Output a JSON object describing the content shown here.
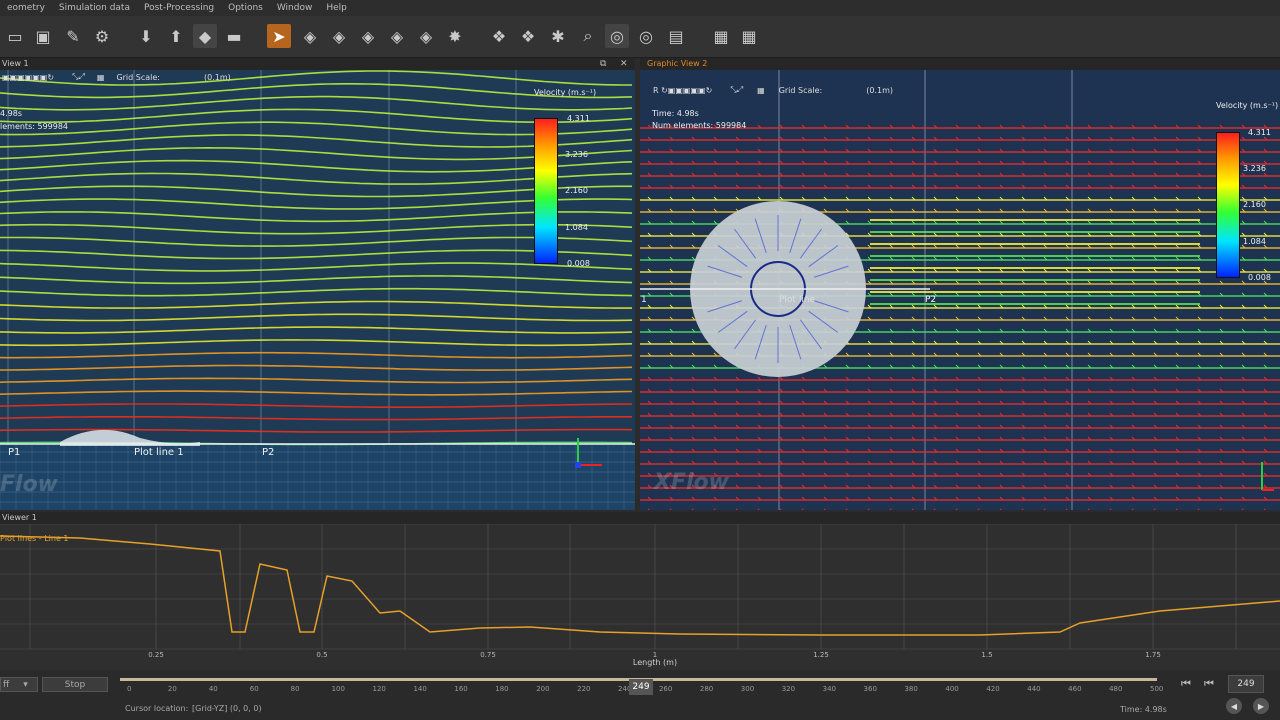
{
  "menu": [
    "eometry",
    "Simulation data",
    "Post-Processing",
    "Options",
    "Window",
    "Help"
  ],
  "toolbar_icons": [
    "open-icon",
    "save-icon",
    "edit-icon",
    "gear-icon",
    "import-icon",
    "export-icon",
    "cube-icon",
    "ruler-icon",
    "select-arrow-icon",
    "select-cube-icon",
    "select-cube-icon",
    "select-cube-icon",
    "select-cube-icon",
    "select-cube-icon",
    "select-burst-icon",
    "transform-icon",
    "transform-icon",
    "wrench-icon",
    "zoom-icon",
    "target-icon",
    "target-icon",
    "clapper-icon",
    "window-icon",
    "window-icon"
  ],
  "view1": {
    "title": "View 1",
    "grid_scale_label": "Grid Scale:",
    "grid_scale_value": "(0.1m)",
    "time": "4.98s",
    "elements": "lements: 599984",
    "colorbar": {
      "title": "Velocity (m.s⁻¹)",
      "labels": [
        "4.311",
        "3.236",
        "2.160",
        "1.084",
        "0.008"
      ]
    },
    "points": {
      "p1": "P1",
      "plot_line": "Plot line 1",
      "p2": "P2"
    },
    "watermark": "Flow"
  },
  "view2": {
    "title": "Graphic View 2",
    "grid_scale_label": "Grid Scale:",
    "grid_scale_value": "(0.1m)",
    "time": "Time: 4.98s",
    "elements": "Num elements: 599984",
    "colorbar": {
      "title": "Velocity (m.s⁻¹)",
      "labels": [
        "4.311",
        "3.236",
        "2.160",
        "1.084",
        "0.008"
      ]
    },
    "points": {
      "p1": "1",
      "plot_line": "Plot line",
      "p2": "P2"
    },
    "watermark": "XFlow"
  },
  "plot": {
    "title": "Viewer 1",
    "series_label": "Plot lines - Line 1",
    "xlabel": "Length (m)",
    "xticks": [
      "0.25",
      "0.5",
      "0.75",
      "1",
      "1.25",
      "1.5",
      "1.75"
    ],
    "accent": "#e6a12a"
  },
  "timeline": {
    "mode_value": "ff",
    "stop_label": "Stop",
    "ticks": [
      "0",
      "20",
      "40",
      "60",
      "80",
      "100",
      "120",
      "140",
      "160",
      "180",
      "200",
      "220",
      "240",
      "260",
      "280",
      "300",
      "320",
      "340",
      "360",
      "380",
      "400",
      "420",
      "440",
      "460",
      "480",
      "500"
    ],
    "current_frame": "249",
    "frame_box": "249",
    "cursor_label": "Cursor location:",
    "cursor_value": "[Grid-YZ] (0, 0, 0)",
    "time_label": "Time: 4.98s"
  }
}
